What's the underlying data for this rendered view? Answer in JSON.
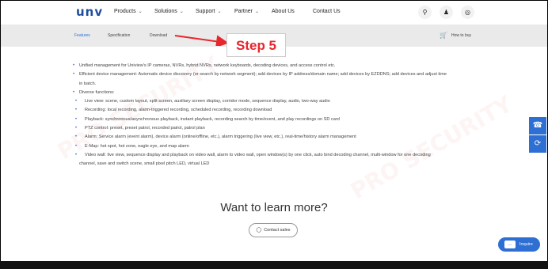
{
  "topnav": {
    "logo": "unv",
    "items": [
      {
        "label": "Products",
        "has_dropdown": true
      },
      {
        "label": "Solutions",
        "has_dropdown": true
      },
      {
        "label": "Support",
        "has_dropdown": true
      },
      {
        "label": "Partner",
        "has_dropdown": true
      },
      {
        "label": "About Us",
        "has_dropdown": false
      },
      {
        "label": "Contact Us",
        "has_dropdown": false
      }
    ],
    "icons": [
      "search-icon",
      "user-icon",
      "globe-icon"
    ]
  },
  "subnav": {
    "tabs": [
      {
        "label": "Features",
        "active": true
      },
      {
        "label": "Specification",
        "active": false
      },
      {
        "label": "Download",
        "active": false
      }
    ],
    "how_to_buy": "How to buy"
  },
  "annotation": {
    "label": "Step 5",
    "color": "#e8262d"
  },
  "features": {
    "lines": [
      "Unified management for Uniview's IP cameras, NVRs, hybrid NVRs, network keyboards, decoding devices, and access control etc.",
      "Efficient device management: Automatic device discovery (or search by network segment); add devices by IP address/domain name; add devices by EZDDNS; add devices and adjust time",
      "in batch.",
      "Diverse functions:",
      "Live view: scene, custom layout, split screen, auxiliary screen display, corridor mode, sequence display, audio, two-way audio",
      "Recording: local recording, alarm-triggered recording, scheduled recording, recording download",
      "Playback: synchronous/asynchronous playback, instant playback, recording search by time/event, and play recordings on SD card",
      "PTZ control: preset, preset patrol, recorded patrol, patrol plan",
      "Alarm: Service alarm (event alarm), device alarm (online/offline, etc.), alarm triggering (live view, etc.), real-time/history alarm management",
      "E-Map: hot spot, hot zone, eagle eye, and map alarm",
      "Video wall: live view, sequence display and playback on video wall, alarm to video wall, open window(s) by one click, auto bind decoding channel, multi-window for one decoding",
      "channel, save and switch scene, small pixel pitch LED, virtual LED"
    ]
  },
  "cta": {
    "title": "Want to learn more?",
    "contact_label": "Contact sales"
  },
  "floating": {
    "inquire_label": "Inquire",
    "side_icons": [
      "support-icon",
      "refresh-icon"
    ]
  },
  "colors": {
    "brand": "#1f4e9c",
    "accent": "#2e6fd3",
    "subnav_bg": "#eaeaea",
    "footer": "#121212"
  }
}
